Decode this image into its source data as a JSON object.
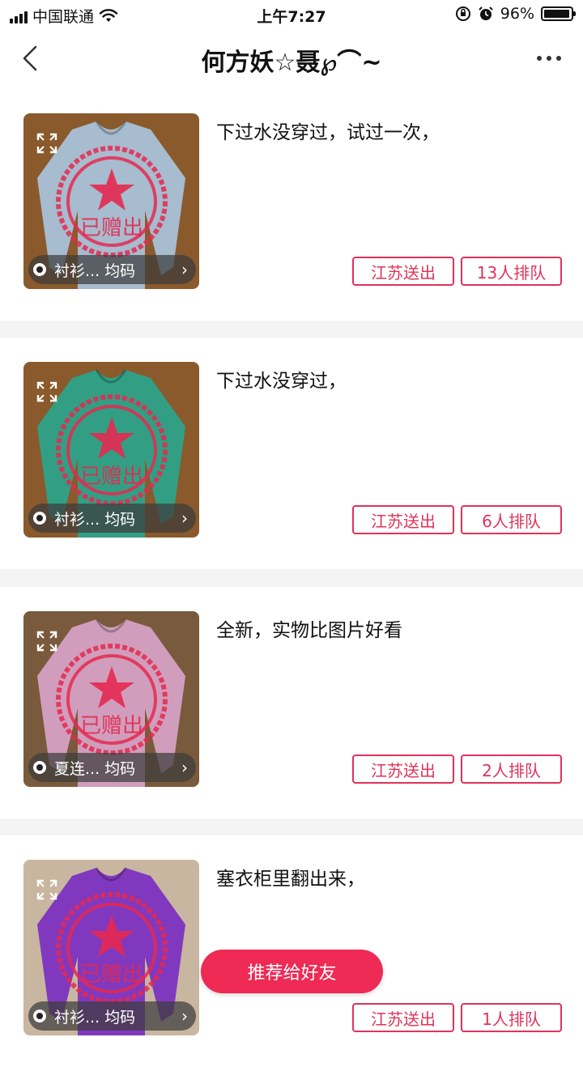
{
  "status": {
    "carrier": "中国联通",
    "time": "上午7:27",
    "battery": "96%",
    "battery_level": 0.96
  },
  "nav": {
    "title": "何方妖☆聂℘⌒~"
  },
  "items": [
    {
      "description": "下过水没穿过，试过一次，",
      "label": "衬衫... 均码",
      "stamp_text": "已赠出",
      "region": "江苏送出",
      "queue": "13人排队",
      "garment_color": "#a9c4dc",
      "bg_color": "#8a5a2c"
    },
    {
      "description": "下过水没穿过，",
      "label": "衬衫... 均码",
      "stamp_text": "已赠出",
      "region": "江苏送出",
      "queue": "6人排队",
      "garment_color": "#2aa58c",
      "bg_color": "#8a5a2c"
    },
    {
      "description": "全新，实物比图片好看",
      "label": "夏连... 均码",
      "stamp_text": "已赠出",
      "region": "江苏送出",
      "queue": "2人排队",
      "garment_color": "#d7a4c8",
      "bg_color": "#7a5a3c"
    },
    {
      "description": "塞衣柜里翻出来，",
      "label": "衬衫... 均码",
      "stamp_text": "已赠出",
      "region": "江苏送出",
      "queue": "1人排队",
      "garment_color": "#7a2fc0",
      "bg_color": "#c9b6a0"
    }
  ],
  "recommend_button": "推荐给好友",
  "colors": {
    "accent": "#e0325a",
    "button": "#ee2a55"
  }
}
